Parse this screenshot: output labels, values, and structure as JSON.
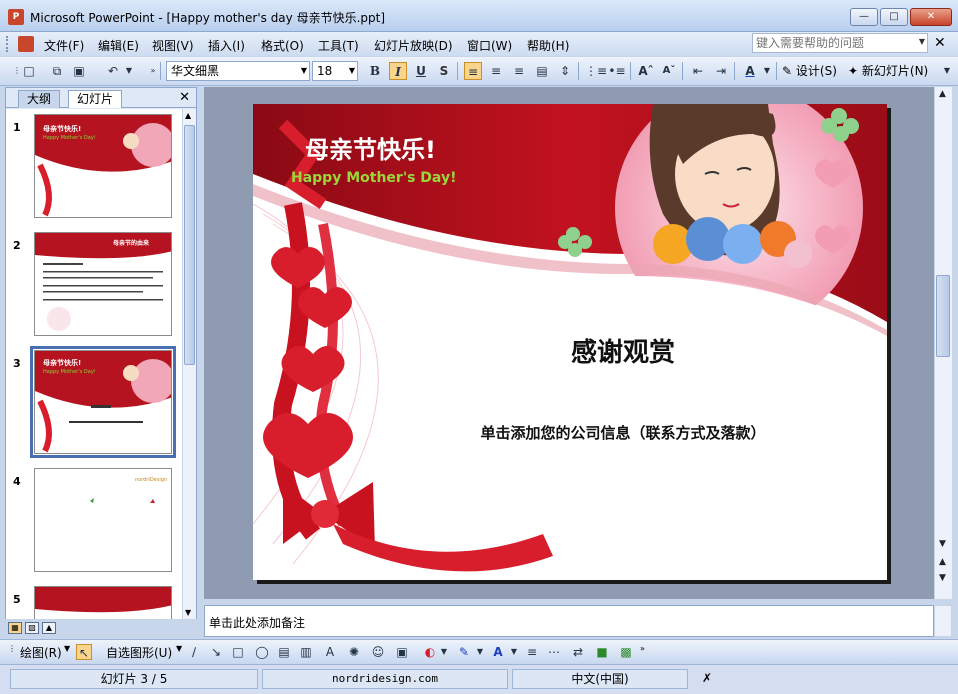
{
  "window": {
    "title": "Microsoft PowerPoint - [Happy mother's day 母亲节快乐.ppt]"
  },
  "menu": {
    "items": [
      "文件(F)",
      "编辑(E)",
      "视图(V)",
      "插入(I)",
      "格式(O)",
      "工具(T)",
      "幻灯片放映(D)",
      "窗口(W)",
      "帮助(H)"
    ],
    "help_placeholder": "键入需要帮助的问题"
  },
  "toolbar": {
    "font_name": "华文细黑",
    "font_size": "18",
    "bold": "B",
    "italic": "I",
    "underline": "U",
    "shadow": "S",
    "design_label": "设计(S)",
    "new_slide_label": "新幻灯片(N)"
  },
  "panel": {
    "tabs": [
      "大纲",
      "幻灯片"
    ],
    "active_tab": 1
  },
  "thumbnails": [
    {
      "num": "1",
      "selected": false,
      "title": "母亲节快乐!",
      "subtitle": "Happy Mother's Day!"
    },
    {
      "num": "2",
      "selected": false,
      "title": "母亲节的由来"
    },
    {
      "num": "3",
      "selected": true,
      "title": "母亲节快乐!",
      "subtitle": "Happy Mother's Day!"
    },
    {
      "num": "4",
      "selected": false,
      "logo": "nordriDesign"
    },
    {
      "num": "5",
      "selected": false
    }
  ],
  "slide": {
    "banner_cn": "母亲节快乐!",
    "banner_en": "Happy Mother's Day!",
    "title": "感谢观赏",
    "subtitle": "单击添加您的公司信息（联系方式及落款）"
  },
  "notes": {
    "placeholder": "单击此处添加备注"
  },
  "drawing": {
    "draw_label": "绘图(R)",
    "autoshapes_label": "自选图形(U)"
  },
  "status": {
    "slide_pos": "幻灯片 3 / 5",
    "template": "nordridesign.com",
    "language": "中文(中国)"
  },
  "colors": {
    "slide_red": "#b5131f",
    "pink": "#f2a7b8",
    "selected_border": "#4a6fb0"
  }
}
